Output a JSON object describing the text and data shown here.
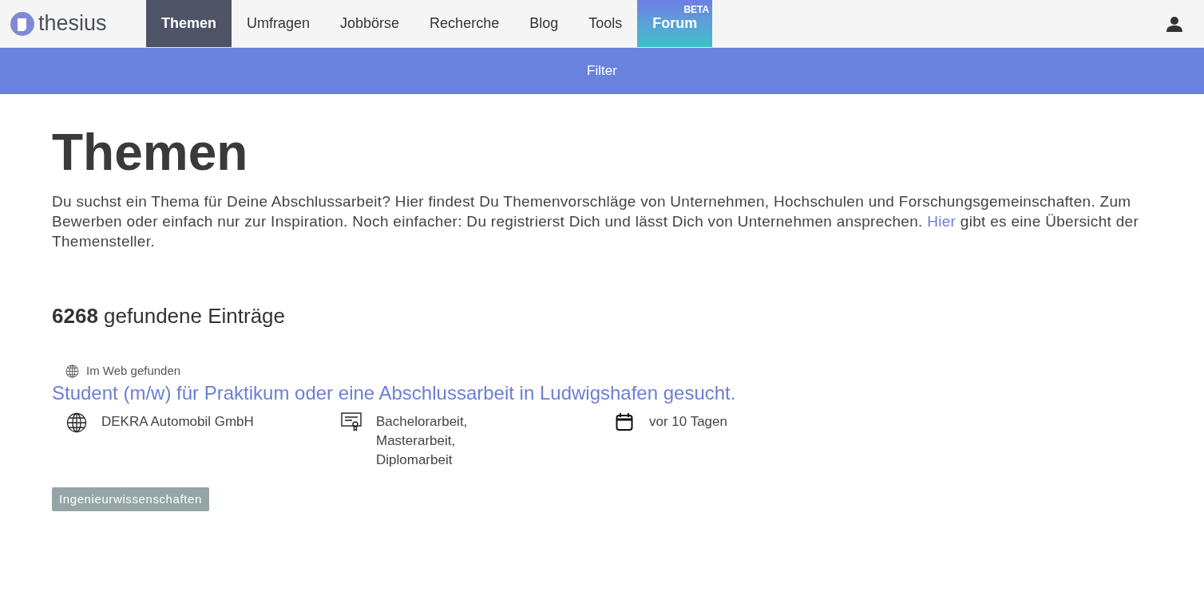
{
  "logo": {
    "text": "thesius"
  },
  "nav": [
    {
      "label": "Themen",
      "selected": true,
      "kind": "plain"
    },
    {
      "label": "Umfragen",
      "selected": false,
      "kind": "plain"
    },
    {
      "label": "Jobbörse",
      "selected": false,
      "kind": "plain"
    },
    {
      "label": "Recherche",
      "selected": false,
      "kind": "plain"
    },
    {
      "label": "Blog",
      "selected": false,
      "kind": "plain"
    },
    {
      "label": "Tools",
      "selected": false,
      "kind": "plain"
    },
    {
      "label": "Forum",
      "selected": false,
      "kind": "featured",
      "badge": "BETA"
    }
  ],
  "filter_bar": {
    "label": "Filter"
  },
  "heading": "Themen",
  "intro": {
    "before": "Du suchst ein Thema für Deine Abschlussarbeit? Hier findest Du Themenvorschläge von Unternehmen, Hochschulen und Forschungsgemeinschaften. Zum Bewerben oder einfach nur zur Inspiration. Noch einfacher: Du registrierst Dich und lässt Dich von Unternehmen ansprechen. ",
    "link": "Hier",
    "after": " gibt es eine Übersicht der Themensteller."
  },
  "result_count": "**6268** gefundene Einträge",
  "results": [
    {
      "source": "Im Web gefunden",
      "title": "Student (m/w) für Praktikum oder eine Abschlussarbeit in Ludwigshafen gesucht.",
      "company": "DEKRA Automobil GmbH",
      "types": [
        "Bachelorarbeit,",
        "Masterarbeit,",
        "Diplomarbeit"
      ],
      "date": "vor 10 Tagen",
      "tags": [
        "Ingenieurwissenschaften"
      ]
    }
  ]
}
